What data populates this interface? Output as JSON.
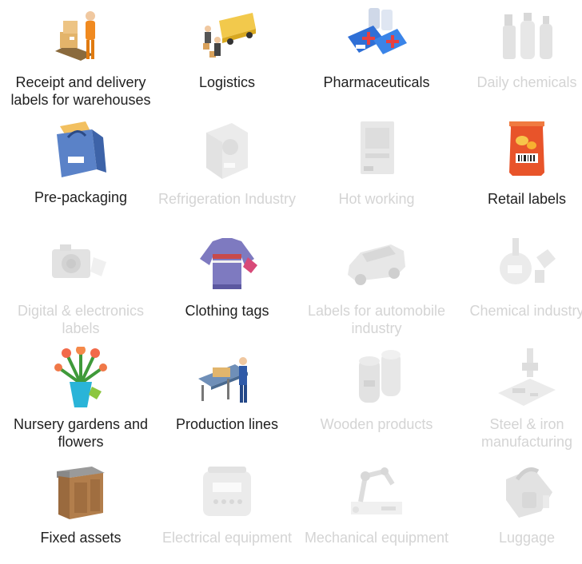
{
  "categories": [
    {
      "label": "Receipt and delivery labels for warehouses",
      "active": true,
      "icon": "warehouse-worker-icon"
    },
    {
      "label": "Logistics",
      "active": true,
      "icon": "delivery-truck-icon"
    },
    {
      "label": "Pharmaceuticals",
      "active": true,
      "icon": "medicine-bottles-icon"
    },
    {
      "label": "Daily chemicals",
      "active": false,
      "icon": "spray-bottles-icon"
    },
    {
      "label": "Pre-packaging",
      "active": true,
      "icon": "paper-bag-icon"
    },
    {
      "label": "Refrigeration Industry",
      "active": false,
      "icon": "food-container-icon"
    },
    {
      "label": "Hot working",
      "active": false,
      "icon": "noodle-package-icon"
    },
    {
      "label": "Retail labels",
      "active": true,
      "icon": "chips-bag-icon"
    },
    {
      "label": "Digital & electronics labels",
      "active": false,
      "icon": "camera-tag-icon"
    },
    {
      "label": "Clothing tags",
      "active": true,
      "icon": "sweater-icon"
    },
    {
      "label": "Labels for automobile industry",
      "active": false,
      "icon": "car-icon"
    },
    {
      "label": "Chemical industry",
      "active": false,
      "icon": "lab-flask-icon"
    },
    {
      "label": "Nursery gardens and flowers",
      "active": true,
      "icon": "flower-vase-icon"
    },
    {
      "label": "Production lines",
      "active": true,
      "icon": "conveyor-worker-icon"
    },
    {
      "label": "Wooden products",
      "active": false,
      "icon": "wood-logs-icon"
    },
    {
      "label": "Steel & iron manufacturing",
      "active": false,
      "icon": "steel-plant-icon"
    },
    {
      "label": "Fixed assets",
      "active": true,
      "icon": "cabinet-icon"
    },
    {
      "label": "Electrical equipment",
      "active": false,
      "icon": "rice-cooker-icon"
    },
    {
      "label": "Mechanical equipment",
      "active": false,
      "icon": "robot-arm-icon"
    },
    {
      "label": "Luggage",
      "active": false,
      "icon": "luggage-bag-icon"
    }
  ]
}
